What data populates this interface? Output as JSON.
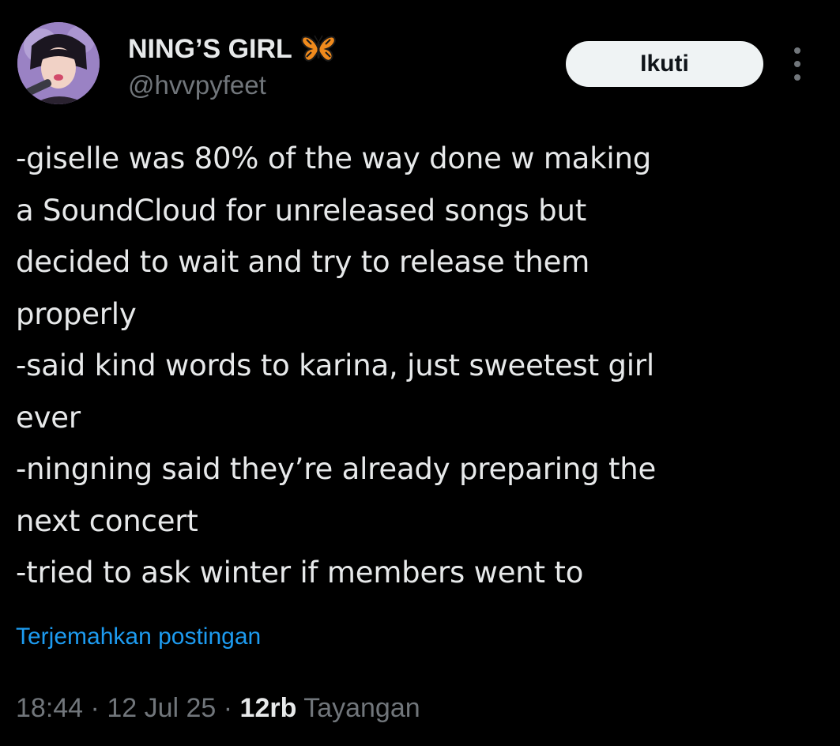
{
  "author": {
    "display_name": "NING’S GIRL",
    "handle": "@hvvpyfeet",
    "name_emoji": "butterfly-icon"
  },
  "follow_button_label": "Ikuti",
  "more_icon": "more-vertical-icon",
  "tweet": {
    "lines": [
      "-giselle was 80% of the way done w making",
      "a SoundCloud for unreleased songs but",
      "decided to wait and try to release them",
      "properly",
      "-said kind words to karina, just sweetest girl",
      "ever",
      "-ningning said they’re already preparing the",
      "next concert",
      "-tried to ask winter if members went to"
    ]
  },
  "translate_label": "Terjemahkan postingan",
  "meta": {
    "time": "18:44",
    "separator": " · ",
    "date": "12 Jul 25",
    "views_count": "12rb",
    "views_label": " Tayangan"
  },
  "colors": {
    "background": "#000000",
    "text": "#e7e9ea",
    "secondary": "#71767b",
    "link": "#1d9bf0",
    "button_bg": "#eff3f4"
  }
}
